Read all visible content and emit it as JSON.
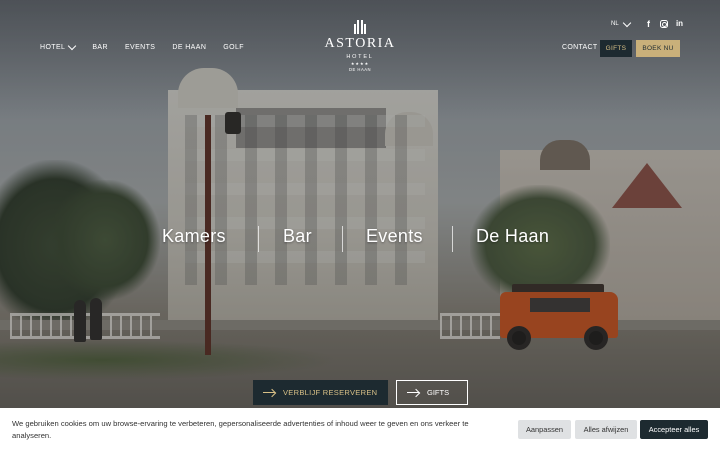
{
  "nav": {
    "items": [
      {
        "label": "HOTEL",
        "has_dropdown": true
      },
      {
        "label": "BAR",
        "has_dropdown": false
      },
      {
        "label": "EVENTS",
        "has_dropdown": false
      },
      {
        "label": "DE HAAN",
        "has_dropdown": false
      },
      {
        "label": "GOLF",
        "has_dropdown": false
      }
    ],
    "contact_label": "CONTACT",
    "gifts_label": "GIFTS",
    "book_label": "BOEK NU"
  },
  "logo": {
    "name": "ASTORIA",
    "subtitle": "HOTEL",
    "stars": "★★★★",
    "place": "DE HAAN"
  },
  "language": {
    "selected": "NL"
  },
  "socials": [
    "facebook-icon",
    "instagram-icon",
    "linkedin-icon"
  ],
  "hero": {
    "links": [
      "Kamers",
      "Bar",
      "Events",
      "De Haan"
    ],
    "cta_reserve": "VERBLIJF RESERVEREN",
    "cta_gifts": "GIFTS"
  },
  "cookie": {
    "text": "We gebruiken cookies om uw browse-ervaring te verbeteren, gepersonaliseerde advertenties of inhoud weer te geven en ons verkeer te analyseren.",
    "customize_label": "Aanpassen",
    "reject_label": "Alles afwijzen",
    "accept_label": "Accepteer alles"
  },
  "colors": {
    "dark": "#1d2a30",
    "gold": "#c9b07a",
    "gold_text": "#d8c087",
    "cookie_bg": "#ffffff"
  }
}
